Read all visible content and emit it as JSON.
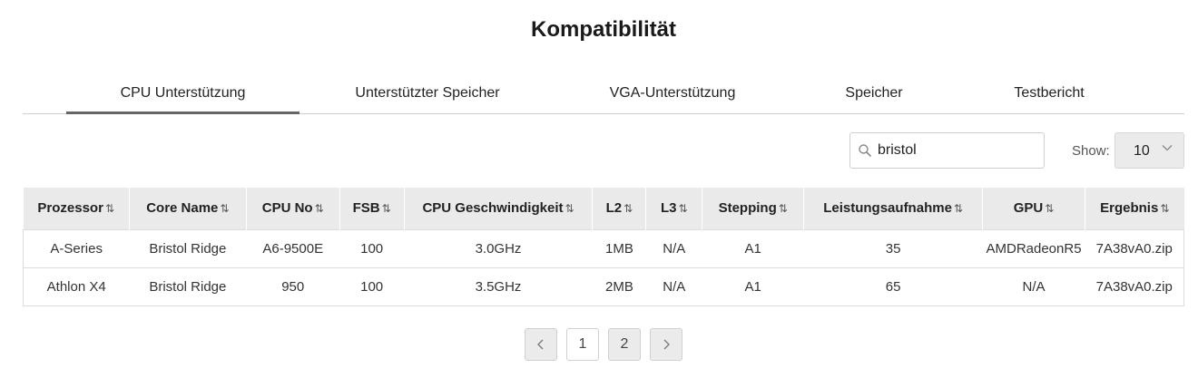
{
  "page": {
    "title": "Kompatibilität"
  },
  "tabs": [
    {
      "label": "CPU Unterstützung",
      "active": true
    },
    {
      "label": "Unterstützter Speicher"
    },
    {
      "label": "VGA-Unterstützung"
    },
    {
      "label": "Speicher"
    },
    {
      "label": "Testbericht"
    }
  ],
  "search": {
    "value": "bristol",
    "icon": "search-icon"
  },
  "show": {
    "label": "Show:",
    "value": "10",
    "icon": "chevron-down-icon"
  },
  "table": {
    "sort_icon": "⇅",
    "headers": [
      "Prozessor",
      "Core Name",
      "CPU No",
      "FSB",
      "CPU Geschwindigkeit",
      "L2",
      "L3",
      "Stepping",
      "Leistungsaufnahme",
      "GPU",
      "Ergebnis"
    ],
    "rows": [
      [
        "A-Series",
        "Bristol Ridge",
        "A6-9500E",
        "100",
        "3.0GHz",
        "1MB",
        "N/A",
        "A1",
        "35",
        "AMDRadeonR5",
        "7A38vA0.zip"
      ],
      [
        "Athlon X4",
        "Bristol Ridge",
        "950",
        "100",
        "3.5GHz",
        "2MB",
        "N/A",
        "A1",
        "65",
        "N/A",
        "7A38vA0.zip"
      ]
    ]
  },
  "pagination": {
    "prev_icon": "chevron-left-icon",
    "pages": [
      "1",
      "2"
    ],
    "current": "2",
    "next_icon": "chevron-right-icon"
  }
}
